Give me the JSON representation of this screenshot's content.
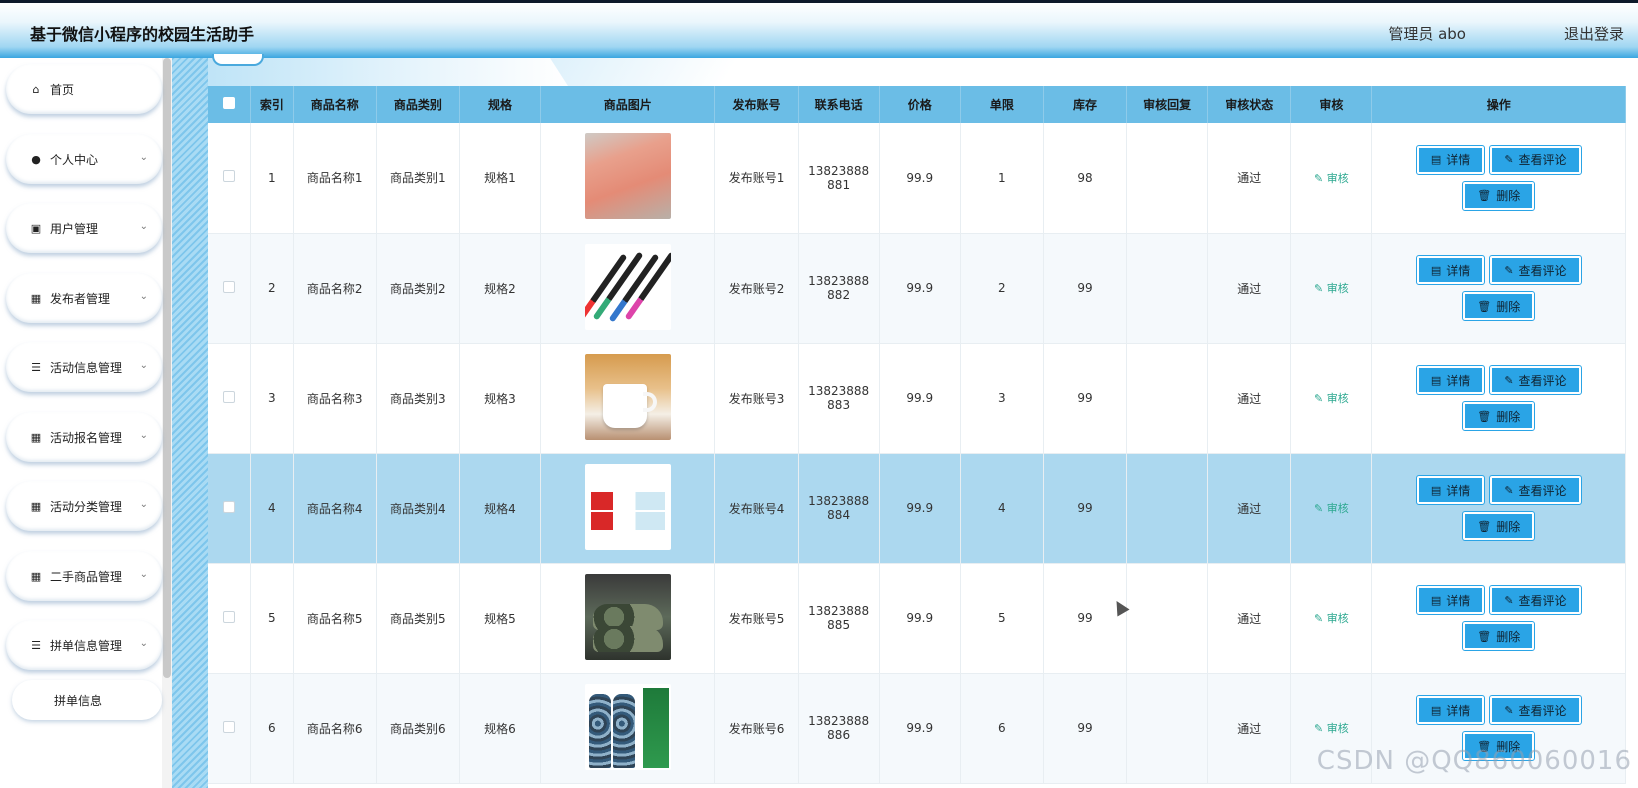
{
  "header": {
    "title": "基于微信小程序的校园生活助手",
    "admin_label": "管理员 abo",
    "logout_label": "退出登录"
  },
  "sidebar": {
    "items": [
      {
        "label": "首页",
        "icon": "home-icon",
        "glyph": "⌂"
      },
      {
        "label": "个人中心",
        "icon": "user-icon",
        "glyph": "●"
      },
      {
        "label": "用户管理",
        "icon": "clipboard-icon",
        "glyph": "▣"
      },
      {
        "label": "发布者管理",
        "icon": "grid-icon",
        "glyph": "▦"
      },
      {
        "label": "活动信息管理",
        "icon": "list-icon",
        "glyph": "☰"
      },
      {
        "label": "活动报名管理",
        "icon": "grid-icon",
        "glyph": "▦"
      },
      {
        "label": "活动分类管理",
        "icon": "grid-icon",
        "glyph": "▦"
      },
      {
        "label": "二手商品管理",
        "icon": "grid-icon",
        "glyph": "▦"
      },
      {
        "label": "拼单信息管理",
        "icon": "list-icon",
        "glyph": "☰"
      }
    ],
    "sub_item": "拼单信息"
  },
  "table": {
    "headers": [
      "索引",
      "商品名称",
      "商品类别",
      "规格",
      "商品图片",
      "发布账号",
      "联系电话",
      "价格",
      "单限",
      "库存",
      "审核回复",
      "审核状态",
      "审核",
      "操作"
    ],
    "rows": [
      {
        "index": "1",
        "name": "商品名称1",
        "category": "商品类别1",
        "spec": "规格1",
        "account": "发布账号1",
        "phone_a": "13823888",
        "phone_b": "881",
        "price": "99.9",
        "limit": "1",
        "stock": "98",
        "reply": "",
        "status": "通过",
        "audit": "审核"
      },
      {
        "index": "2",
        "name": "商品名称2",
        "category": "商品类别2",
        "spec": "规格2",
        "account": "发布账号2",
        "phone_a": "13823888",
        "phone_b": "882",
        "price": "99.9",
        "limit": "2",
        "stock": "99",
        "reply": "",
        "status": "通过",
        "audit": "审核"
      },
      {
        "index": "3",
        "name": "商品名称3",
        "category": "商品类别3",
        "spec": "规格3",
        "account": "发布账号3",
        "phone_a": "13823888",
        "phone_b": "883",
        "price": "99.9",
        "limit": "3",
        "stock": "99",
        "reply": "",
        "status": "通过",
        "audit": "审核"
      },
      {
        "index": "4",
        "name": "商品名称4",
        "category": "商品类别4",
        "spec": "规格4",
        "account": "发布账号4",
        "phone_a": "13823888",
        "phone_b": "884",
        "price": "99.9",
        "limit": "4",
        "stock": "99",
        "reply": "",
        "status": "通过",
        "audit": "审核"
      },
      {
        "index": "5",
        "name": "商品名称5",
        "category": "商品类别5",
        "spec": "规格5",
        "account": "发布账号5",
        "phone_a": "13823888",
        "phone_b": "885",
        "price": "99.9",
        "limit": "5",
        "stock": "99",
        "reply": "",
        "status": "通过",
        "audit": "审核"
      },
      {
        "index": "6",
        "name": "商品名称6",
        "category": "商品类别6",
        "spec": "规格6",
        "account": "发布账号6",
        "phone_a": "13823888",
        "phone_b": "886",
        "price": "99.9",
        "limit": "6",
        "stock": "99",
        "reply": "",
        "status": "通过",
        "audit": "审核"
      }
    ],
    "actions": {
      "detail": "详情",
      "comments": "查看评论",
      "delete": "删除"
    }
  },
  "watermark": "CSDN @QQ860060016",
  "colors": {
    "header_bg": "#6bbde6",
    "button": "#2aa4e6",
    "highlight_row": "#acd8ef",
    "audit_link": "#2ca890"
  }
}
